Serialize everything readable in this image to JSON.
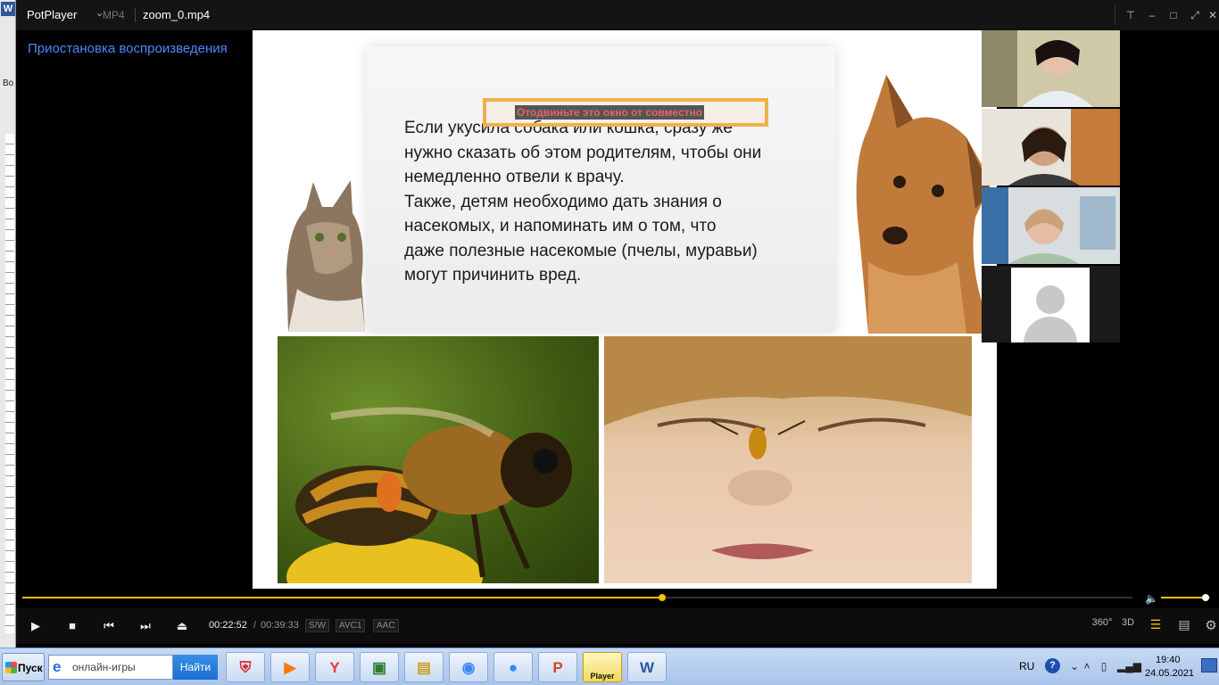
{
  "background_window": {
    "icon_letter": "W",
    "partial_text": "Во"
  },
  "titlebar": {
    "brand": "PotPlayer",
    "format": "MP4",
    "filename": "zoom_0.mp4"
  },
  "video": {
    "status_text": "Приостановка воспроизведения",
    "share_warning": "Отодвиньте это окно от совместно",
    "slide_lines": [
      " Если укусила собака или кошка, сразу же",
      "нужно сказать об этом родителям, чтобы они",
      "немедленно отвели к врачу.",
      "Также, детям необходимо дать знания о",
      "насекомых, и напоминать им о том, что",
      "даже полезные насекомые (пчелы, муравьи)",
      "могут причинить вред."
    ]
  },
  "playback": {
    "progress_fraction": 0.576,
    "volume_fraction": 0.9,
    "current_time": "00:22:52",
    "separator": "/",
    "total_time": "00:39:33",
    "tags": [
      "S/W",
      "AVC1",
      "AAC"
    ],
    "right_buttons": [
      "360°",
      "3D"
    ]
  },
  "taskbar": {
    "start_label": "Пуск",
    "search_placeholder": "онлайн-игры",
    "search_button": "Найти",
    "apps": [
      {
        "name": "shield-app",
        "glyph": "⛨",
        "color": "#d32f2f"
      },
      {
        "name": "video-app",
        "glyph": "▶",
        "color": "#f57c00"
      },
      {
        "name": "yandex-browser",
        "glyph": "Y",
        "color": "#e53935"
      },
      {
        "name": "image-viewer",
        "glyph": "▣",
        "color": "#2e7d32"
      },
      {
        "name": "file-explorer",
        "glyph": "▤",
        "color": "#c9a227"
      },
      {
        "name": "chrome",
        "glyph": "◉",
        "color": "#4285f4"
      },
      {
        "name": "zoom",
        "glyph": "●",
        "color": "#2d8cff"
      },
      {
        "name": "powerpoint",
        "glyph": "P",
        "color": "#d24726"
      },
      {
        "name": "potplayer",
        "glyph": "Player",
        "color": "#111111",
        "active": true
      },
      {
        "name": "word",
        "glyph": "W",
        "color": "#2b579a"
      }
    ],
    "language": "RU",
    "help": "?",
    "time": "19:40",
    "date": "24.05.2021"
  },
  "colors": {
    "accent_yellow": "#f0c20a",
    "status_blue": "#4f86ff",
    "warning_orange": "#f0b14a"
  }
}
